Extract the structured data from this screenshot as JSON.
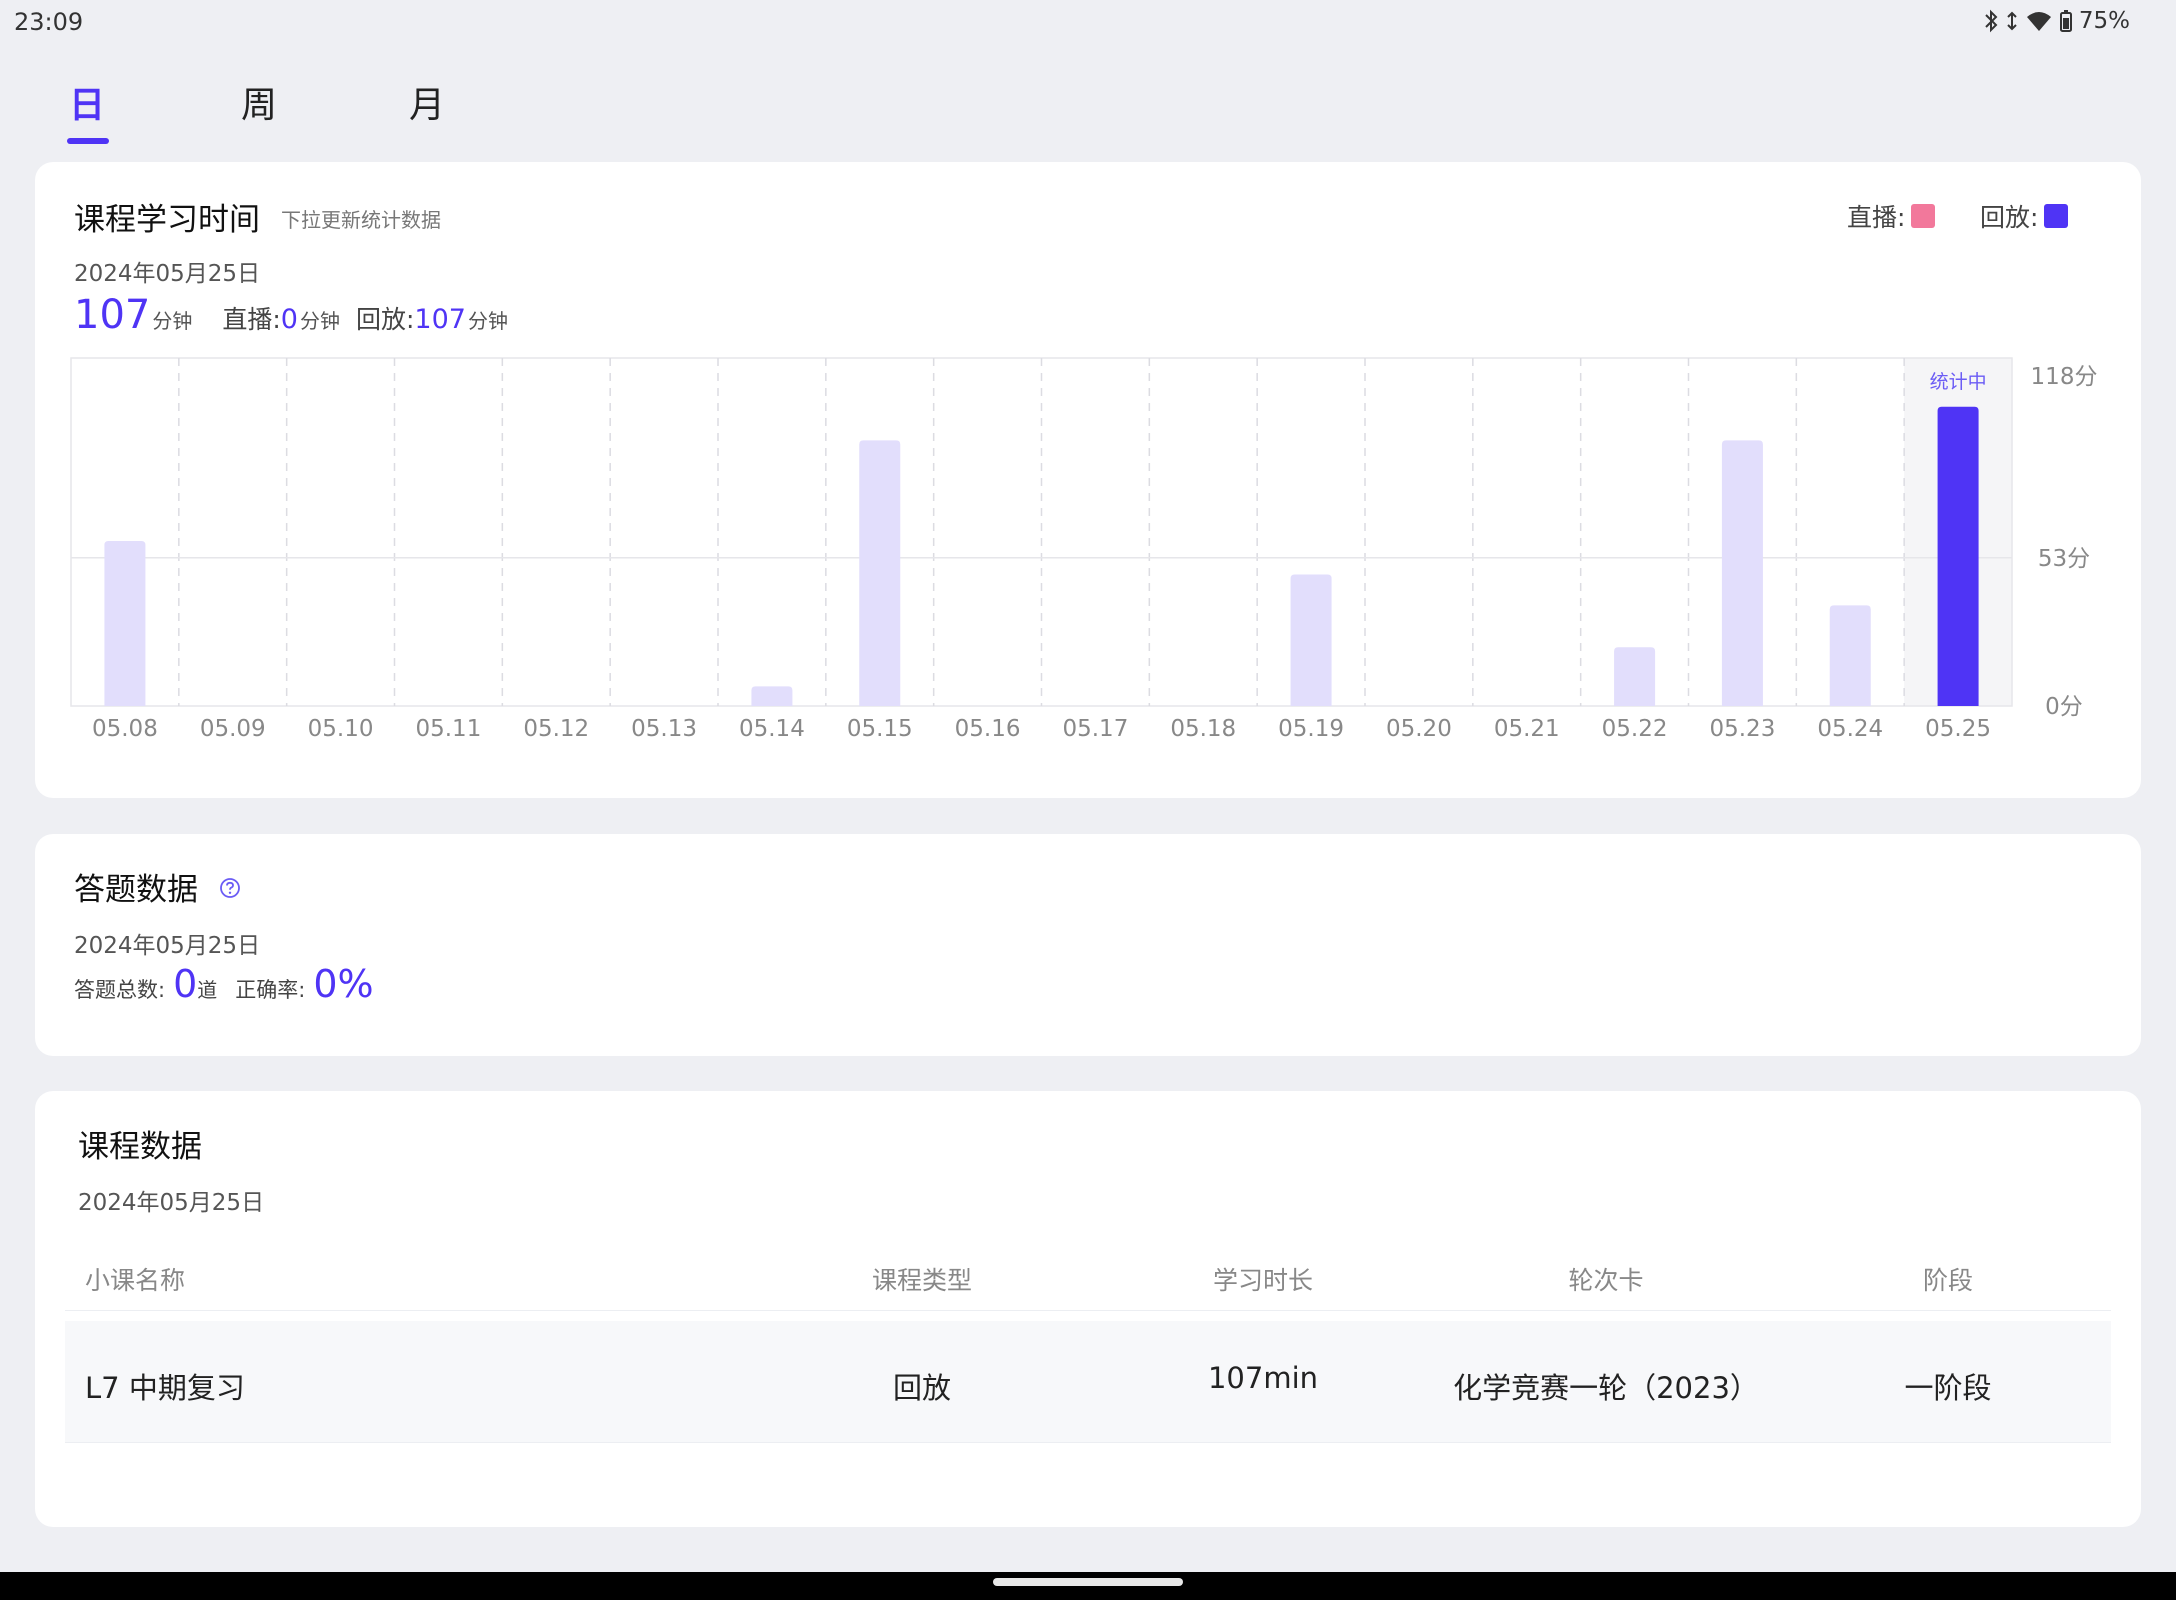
{
  "status": {
    "time": "23:09",
    "battery": "75%"
  },
  "tabs": [
    {
      "label": "日",
      "active": true
    },
    {
      "label": "周",
      "active": false
    },
    {
      "label": "月",
      "active": false
    }
  ],
  "time_card": {
    "title": "课程学习时间",
    "subtitle": "下拉更新统计数据",
    "legend": [
      {
        "label": "直播:",
        "color": "#f2789b"
      },
      {
        "label": "回放:",
        "color": "#4f34f5"
      }
    ],
    "date": "2024年05月25日",
    "total": "107",
    "total_unit": "分钟",
    "live_label": "直播:",
    "live_value": "0",
    "live_unit": "分钟",
    "replay_label": "回放:",
    "replay_value": "107",
    "replay_unit": "分钟"
  },
  "chart_data": {
    "type": "bar",
    "categories": [
      "05.08",
      "05.09",
      "05.10",
      "05.11",
      "05.12",
      "05.13",
      "05.14",
      "05.15",
      "05.16",
      "05.17",
      "05.18",
      "05.19",
      "05.20",
      "05.21",
      "05.22",
      "05.23",
      "05.24",
      "05.25"
    ],
    "values": [
      59,
      0,
      0,
      0,
      0,
      0,
      7,
      95,
      0,
      0,
      0,
      47,
      0,
      0,
      21,
      95,
      36,
      107
    ],
    "y_ticks": [
      "118分",
      "53分",
      "0分"
    ],
    "y_tick_values": [
      118,
      53,
      0
    ],
    "ylim": [
      0,
      118
    ],
    "highlight_index": 17,
    "highlight_label": "统计中",
    "colors": {
      "highlight": "#4f34f5",
      "normal": "#e2defc",
      "highlight_bg": "#f5f5f7"
    }
  },
  "answers_card": {
    "title": "答题数据",
    "date": "2024年05月25日",
    "total_label": "答题总数:",
    "total_value": "0",
    "total_unit": "道",
    "accuracy_label": "正确率:",
    "accuracy_value": "0%"
  },
  "courses_card": {
    "title": "课程数据",
    "date": "2024年05月25日",
    "columns": [
      "小课名称",
      "课程类型",
      "学习时长",
      "轮次卡",
      "阶段"
    ],
    "rows": [
      {
        "name": "L7 中期复习",
        "type": "回放",
        "duration": "107min",
        "round": "化学竞赛一轮（2023）",
        "stage": "一阶段"
      }
    ]
  }
}
